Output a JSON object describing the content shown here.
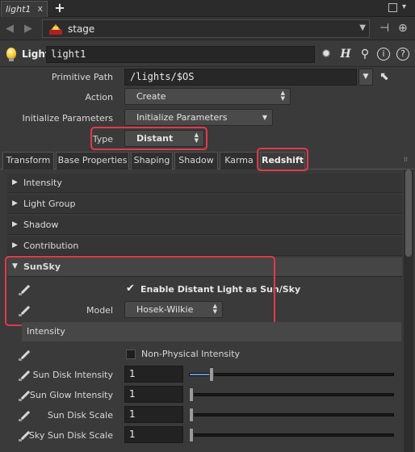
{
  "window": {
    "tab_label": "light1",
    "tab_close": "x",
    "add_tab": "+"
  },
  "path_bar": {
    "context": "stage"
  },
  "node_header": {
    "type_label": "Light",
    "node_name": "light1",
    "help_symbol": "?",
    "info_symbol": "i",
    "h_symbol": "H"
  },
  "params": {
    "primitive_path_label": "Primitive Path",
    "primitive_path_value": "/lights/$OS",
    "action_label": "Action",
    "action_value": "Create",
    "init_params_label": "Initialize Parameters",
    "init_params_value": "Initialize Parameters",
    "type_label": "Type",
    "type_value": "Distant"
  },
  "property_tabs": [
    {
      "label": "Transform"
    },
    {
      "label": "Base Properties"
    },
    {
      "label": "Shaping"
    },
    {
      "label": "Shadow"
    },
    {
      "label": "Karma"
    },
    {
      "label": "Redshift",
      "active": true
    }
  ],
  "folders": {
    "intensity": "Intensity",
    "light_group": "Light Group",
    "shadow": "Shadow",
    "contribution": "Contribution",
    "sunsky": "SunSky"
  },
  "sunsky": {
    "enable_label": "Enable Distant Light as Sun/Sky",
    "enable_checked": true,
    "model_label": "Model",
    "model_value": "Hosek-Wilkie",
    "intensity_subheader": "Intensity",
    "non_physical_label": "Non-Physical Intensity",
    "non_physical_checked": false,
    "sliders": [
      {
        "label": "Sun Disk Intensity",
        "value": "1",
        "fraction": 0.1
      },
      {
        "label": "Sun Glow Intensity",
        "value": "1",
        "fraction": 0.0
      },
      {
        "label": "Sun Disk Scale",
        "value": "1",
        "fraction": 0.0
      },
      {
        "label": "Sky Sun Disk Scale",
        "value": "1",
        "fraction": 0.0
      }
    ]
  },
  "colors": {
    "highlight": "#e03a4a",
    "slider_fill": "#6a8fd0"
  }
}
